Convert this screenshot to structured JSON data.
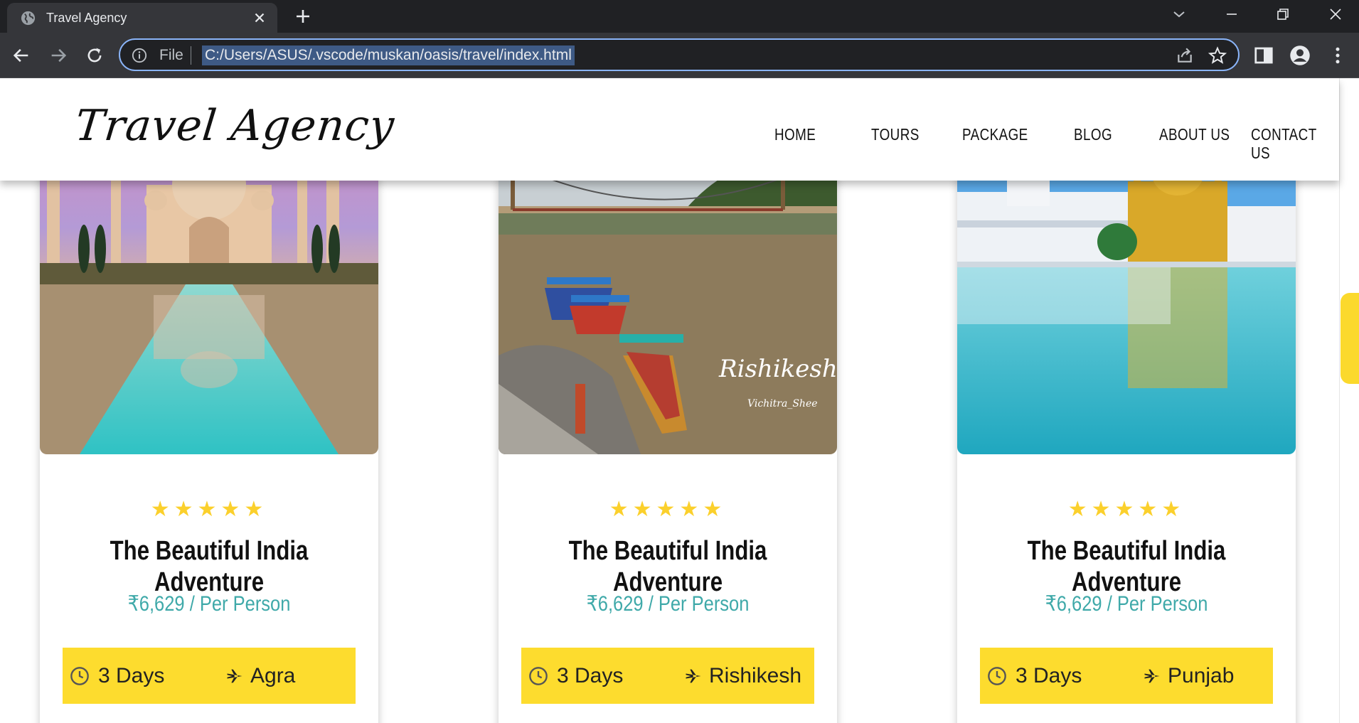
{
  "browser": {
    "tab_title": "Travel Agency",
    "omnibox_label": "File",
    "url": "C:/Users/ASUS/.vscode/muskan/oasis/travel/index.html"
  },
  "site": {
    "logo": "Travel Agency",
    "nav": [
      "HOME",
      "TOURS",
      "PACKAGE",
      "BLOG",
      "ABOUT US",
      "CONTACT US"
    ]
  },
  "cards": [
    {
      "image": "taj-mahal-photo",
      "stars": "★★★★★",
      "rating": 5,
      "title": "The Beautiful India Adventure",
      "price": "₹6,629 / Per Person",
      "days": "3 Days",
      "destination": "Agra"
    },
    {
      "image": "rishikesh-river-photo",
      "image_caption": "Rishikesh",
      "image_signature": "Vichitra_Shee",
      "stars": "★★★★★",
      "rating": 5,
      "title": "The Beautiful India Adventure",
      "price": "₹6,629 / Per Person",
      "days": "3 Days",
      "destination": "Rishikesh"
    },
    {
      "image": "golden-temple-photo",
      "stars": "★★★★★",
      "rating": 5,
      "title": "The Beautiful India Adventure",
      "price": "₹6,629 / Per Person",
      "days": "3 Days",
      "destination": "Punjab"
    }
  ],
  "colors": {
    "accent": "#fddc2e",
    "price": "#3fa9a9",
    "star": "#fbd02c",
    "chrome_dark": "#202124"
  }
}
